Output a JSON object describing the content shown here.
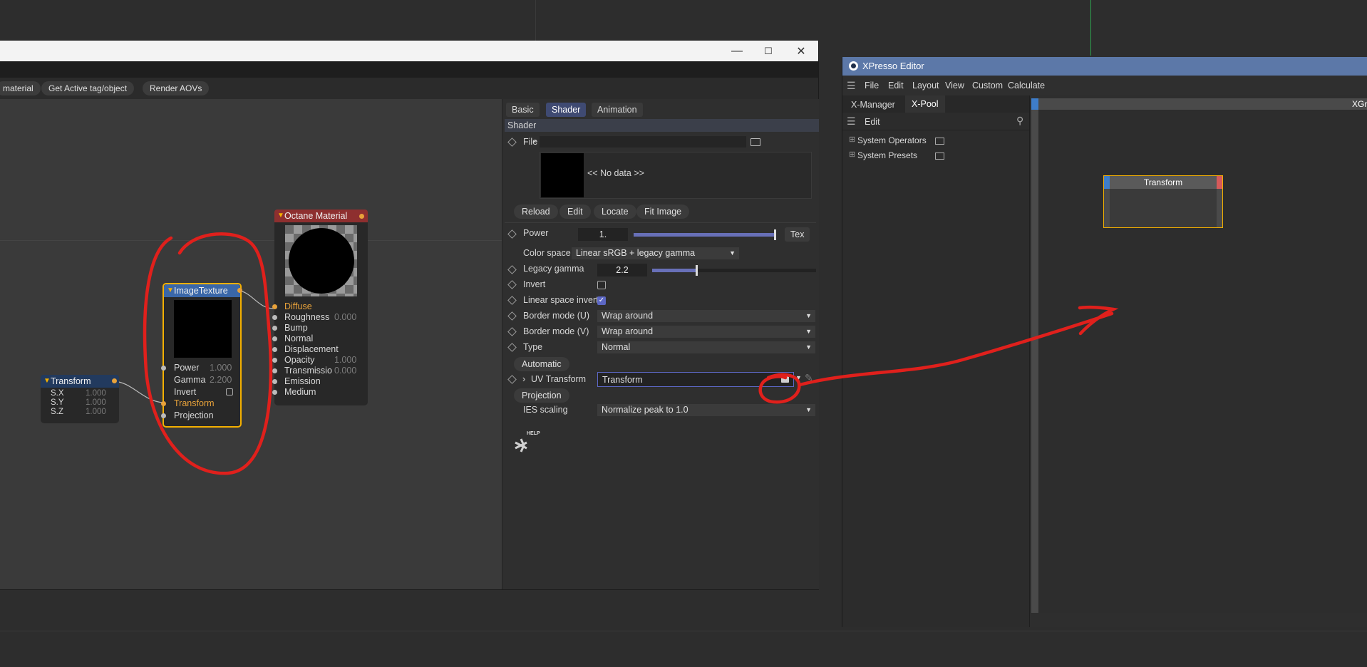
{
  "node_window": {
    "toolbar": [
      "material",
      "Get Active tag/object",
      "Render AOVs"
    ],
    "controls": {
      "minimize": "—",
      "maximize": "☐",
      "close": "✕"
    }
  },
  "nodes": {
    "octane": {
      "title": "Octane Material",
      "inputs": [
        {
          "label": "Diffuse",
          "value": ""
        },
        {
          "label": "Roughness",
          "value": "0.000"
        },
        {
          "label": "Bump",
          "value": ""
        },
        {
          "label": "Normal",
          "value": ""
        },
        {
          "label": "Displacement",
          "value": ""
        },
        {
          "label": "Opacity",
          "value": "1.000"
        },
        {
          "label": "Transmissio",
          "value": "0.000"
        },
        {
          "label": "Emission",
          "value": ""
        },
        {
          "label": "Medium",
          "value": ""
        }
      ]
    },
    "image_texture": {
      "title": "ImageTexture",
      "inputs": [
        {
          "label": "Power",
          "value": "1.000"
        },
        {
          "label": "Gamma",
          "value": "2.200"
        },
        {
          "label": "Invert",
          "value": ""
        },
        {
          "label": "Transform",
          "value": ""
        },
        {
          "label": "Projection",
          "value": ""
        }
      ]
    },
    "transform": {
      "title": "Transform",
      "rows": [
        {
          "label": "S.X",
          "value": "1.000"
        },
        {
          "label": "S.Y",
          "value": "1.000"
        },
        {
          "label": "S.Z",
          "value": "1.000"
        }
      ]
    }
  },
  "panel": {
    "tabs": [
      "Basic",
      "Shader",
      "Animation"
    ],
    "active_tab": "Shader",
    "section": "Shader",
    "file_label": "File",
    "no_data": "<< No data >>",
    "file_buttons": [
      "Reload",
      "Edit",
      "Locate",
      "Fit Image"
    ],
    "power": {
      "label": "Power",
      "value": "1.",
      "tex": "Tex",
      "fraction": 1.0
    },
    "color_space": {
      "label": "Color space",
      "value": "Linear sRGB + legacy gamma"
    },
    "legacy_gamma": {
      "label": "Legacy gamma",
      "value": "2.2",
      "fraction": 0.27
    },
    "invert": {
      "label": "Invert",
      "checked": false
    },
    "linear_space_invert": {
      "label": "Linear space invert",
      "checked": true
    },
    "border_u": {
      "label": "Border mode (U)",
      "value": "Wrap around"
    },
    "border_v": {
      "label": "Border mode (V)",
      "value": "Wrap around"
    },
    "type": {
      "label": "Type",
      "value": "Normal"
    },
    "automatic": "Automatic",
    "uv_transform": {
      "label": "UV Transform",
      "value": "Transform"
    },
    "projection": "Projection",
    "ies_scaling": {
      "label": "IES scaling",
      "value": "Normalize peak to 1.0"
    },
    "help": "HELP"
  },
  "xpresso": {
    "title": "XPresso Editor",
    "menu": [
      "File",
      "Edit",
      "Layout",
      "View",
      "Custom",
      "Calculate"
    ],
    "tabs": [
      "X-Manager",
      "X-Pool"
    ],
    "active_tab": "X-Pool",
    "edit_label": "Edit",
    "tree": [
      "System Operators",
      "System Presets"
    ],
    "graph_title": "XGr",
    "node_title": "Transform"
  },
  "colors": {
    "accent": "#5c67c4",
    "annotation": "#e0201c",
    "xpresso_title": "#5c78a8",
    "node_select": "#f4b000"
  }
}
